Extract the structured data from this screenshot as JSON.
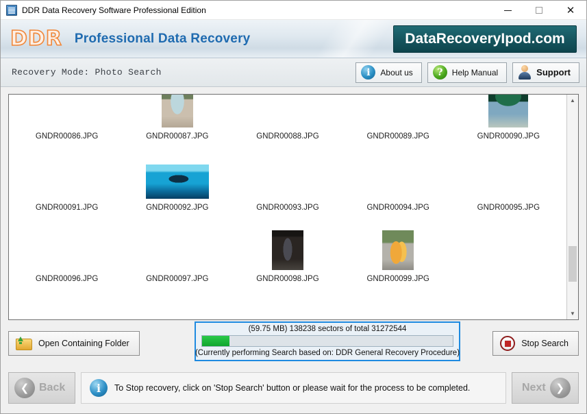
{
  "window": {
    "title": "DDR Data Recovery Software Professional Edition",
    "icon": "app-icon",
    "controls": {
      "minimize": "—",
      "maximize": "□",
      "close": "✕"
    }
  },
  "brand": {
    "logo_text": "DDR",
    "title": "Professional Data Recovery",
    "url_badge": "DataRecoveryIpod.com",
    "url_badge_color": "#16565f",
    "title_color": "#1f6bb0",
    "logo_color": "#f0873a"
  },
  "modebar": {
    "mode_text": "Recovery Mode: Photo Search",
    "buttons": [
      {
        "label": "About us",
        "icon": "info-icon",
        "icon_color": "#2a8fc4"
      },
      {
        "label": "Help Manual",
        "icon": "question-icon",
        "icon_color": "#4aa81d"
      },
      {
        "label": "Support",
        "icon": "person-icon",
        "icon_color": "#1f3a5c"
      }
    ]
  },
  "filelist": {
    "items": [
      {
        "name": "GNDR00086.JPG",
        "shape": "wide",
        "pic": "p86"
      },
      {
        "name": "GNDR00087.JPG",
        "shape": "portrait",
        "pic": "p87"
      },
      {
        "name": "GNDR00088.JPG",
        "shape": "wide",
        "pic": "p88"
      },
      {
        "name": "GNDR00089.JPG",
        "shape": "wide",
        "pic": "p89"
      },
      {
        "name": "GNDR00090.JPG",
        "shape": "square",
        "pic": "p90"
      },
      {
        "name": "GNDR00091.JPG",
        "shape": "square",
        "pic": "p91"
      },
      {
        "name": "GNDR00092.JPG",
        "shape": "wide",
        "pic": "p92"
      },
      {
        "name": "GNDR00093.JPG",
        "shape": "wide",
        "pic": "p93"
      },
      {
        "name": "GNDR00094.JPG",
        "shape": "wide",
        "pic": "p94"
      },
      {
        "name": "GNDR00095.JPG",
        "shape": "wide",
        "pic": "p95"
      },
      {
        "name": "GNDR00096.JPG",
        "shape": "square",
        "pic": "p96"
      },
      {
        "name": "GNDR00097.JPG",
        "shape": "wide",
        "pic": "p97"
      },
      {
        "name": "GNDR00098.JPG",
        "shape": "portrait",
        "pic": "p98"
      },
      {
        "name": "GNDR00099.JPG",
        "shape": "portrait",
        "pic": "p99"
      }
    ],
    "scrollbar": {
      "up_arrow": "▲",
      "down_arrow": "▼"
    }
  },
  "actions": {
    "open_folder_label": "Open Containing Folder",
    "stop_search_label": "Stop Search",
    "progress": {
      "top_text": "(59.75 MB) 138238  sectors  of  total 31272544",
      "bottom_text": "(Currently performing Search based on:  DDR General Recovery Procedure)",
      "size_mb": "59.75 MB",
      "sectors_done": "138238",
      "sectors_total": "31272544",
      "percent": 11,
      "fill_color": "#1ab438",
      "border_color": "#1e8ae0"
    }
  },
  "footer": {
    "back_label": "Back",
    "next_label": "Next",
    "back_enabled": false,
    "next_enabled": false,
    "back_arrow": "❮",
    "next_arrow": "❯",
    "hint_text": "To Stop recovery, click on 'Stop Search' button or please wait for the process to be completed.",
    "hint_icon": "info-icon"
  }
}
